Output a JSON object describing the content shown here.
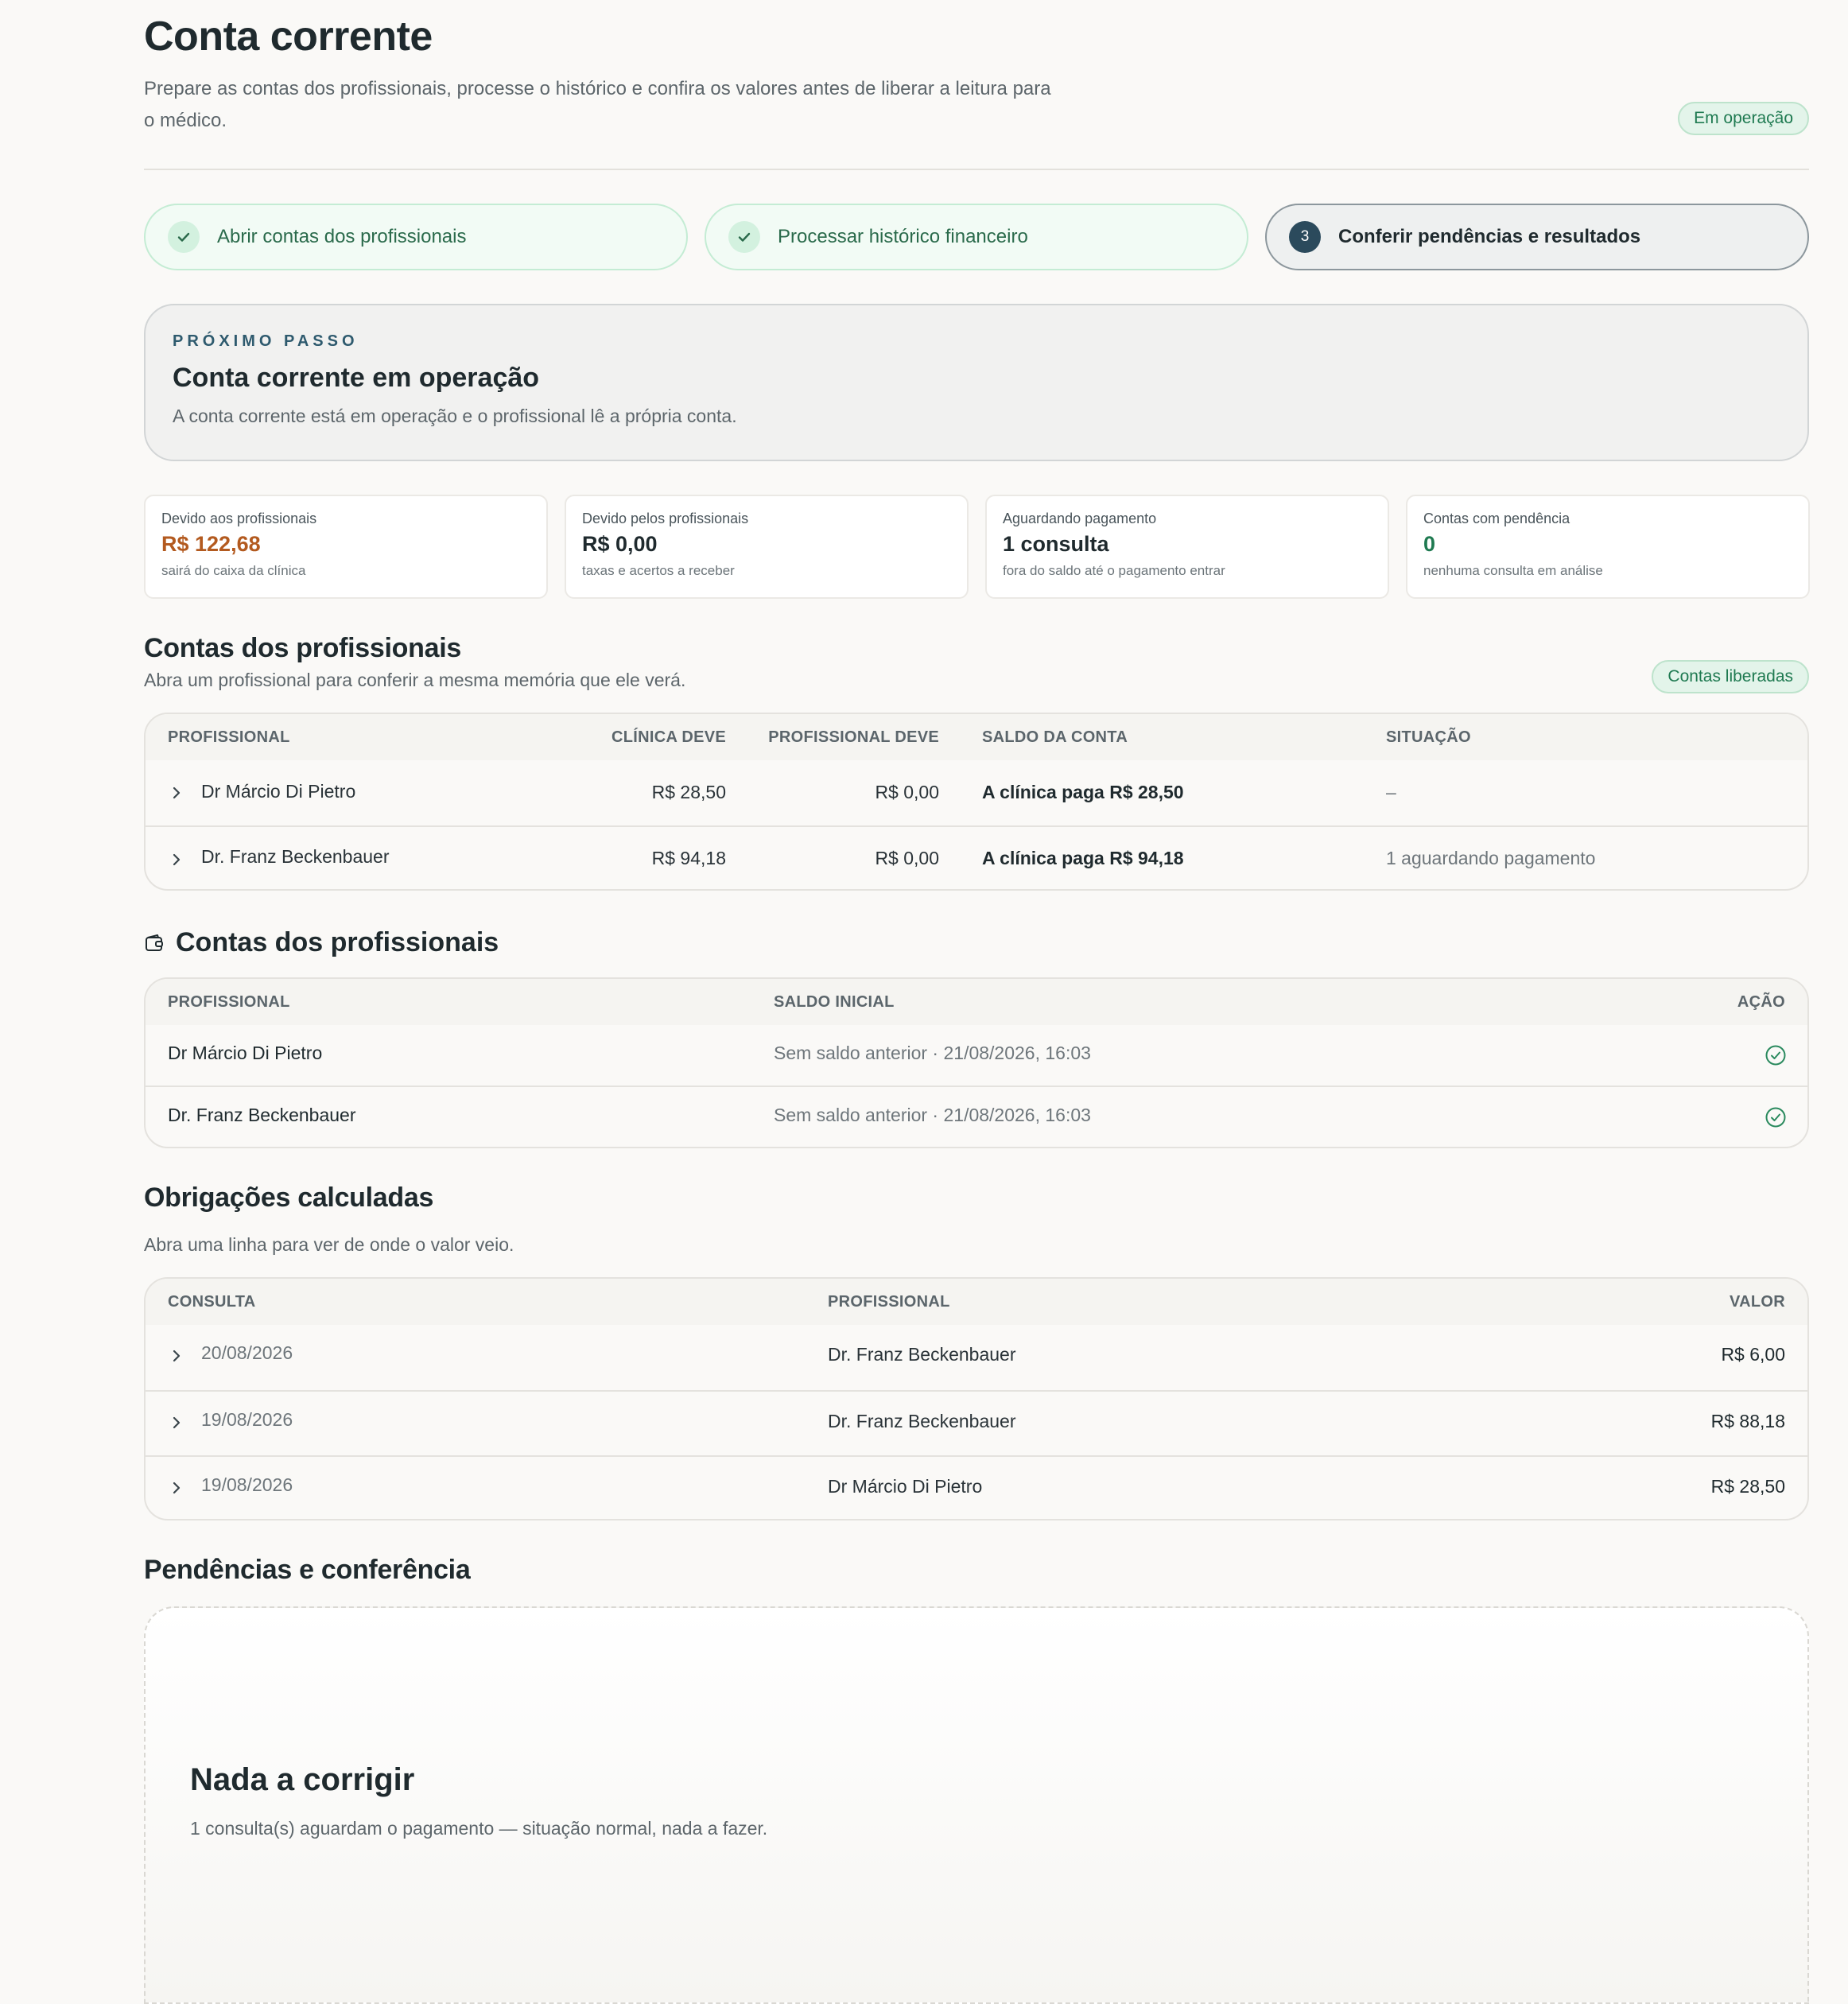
{
  "header": {
    "title": "Conta corrente",
    "subtitle": "Prepare as contas dos profissionais, processe o histórico e confira os valores antes de liberar a leitura para o médico.",
    "status": "Em operação"
  },
  "steps": [
    {
      "label": "Abrir contas dos profissionais",
      "state": "done"
    },
    {
      "label": "Processar histórico financeiro",
      "state": "done"
    },
    {
      "label": "Conferir pendências e resultados",
      "state": "current",
      "number": "3"
    }
  ],
  "next_step": {
    "kicker": "PRÓXIMO PASSO",
    "title": "Conta corrente em operação",
    "description": "A conta corrente está em operação e o profissional lê a própria conta."
  },
  "metrics": [
    {
      "label": "Devido aos profissionais",
      "value": "R$ 122,68",
      "note": "sairá do caixa da clínica",
      "color": "#b35a1f"
    },
    {
      "label": "Devido pelos profissionais",
      "value": "R$ 0,00",
      "note": "taxas e acertos a receber",
      "color": "#1f2a2e"
    },
    {
      "label": "Aguardando pagamento",
      "value": "1 consulta",
      "note": "fora do saldo até o pagamento entrar",
      "color": "#1f2a2e"
    },
    {
      "label": "Contas com pendência",
      "value": "0",
      "note": "nenhuma consulta em análise",
      "color": "#1f7a51"
    }
  ],
  "accounts": {
    "title": "Contas dos profissionais",
    "subtitle": "Abra um profissional para conferir a mesma memória que ele verá.",
    "badge": "Contas liberadas",
    "headers": {
      "professional": "PROFISSIONAL",
      "clinic_owes": "CLÍNICA DEVE",
      "pro_owes": "PROFISSIONAL DEVE",
      "balance": "SALDO DA CONTA",
      "status": "SITUAÇÃO"
    },
    "rows": [
      {
        "name": "Dr Márcio Di Pietro",
        "clinic_owes": "R$ 28,50",
        "pro_owes": "R$ 0,00",
        "balance": "A clínica paga R$ 28,50",
        "status": "–"
      },
      {
        "name": "Dr. Franz Beckenbauer",
        "clinic_owes": "R$ 94,18",
        "pro_owes": "R$ 0,00",
        "balance": "A clínica paga R$ 94,18",
        "status": "1 aguardando pagamento"
      }
    ]
  },
  "opening": {
    "title": "Contas dos profissionais",
    "icon": "wallet-icon",
    "headers": {
      "professional": "PROFISSIONAL",
      "initial": "SALDO INICIAL",
      "action": "AÇÃO"
    },
    "rows": [
      {
        "name": "Dr Márcio Di Pietro",
        "initial": "Sem saldo anterior · 21/08/2026, 16:03"
      },
      {
        "name": "Dr. Franz Beckenbauer",
        "initial": "Sem saldo anterior · 21/08/2026, 16:03"
      }
    ]
  },
  "obligations": {
    "title": "Obrigações calculadas",
    "subtitle": "Abra uma linha para ver de onde o valor veio.",
    "headers": {
      "consultation": "CONSULTA",
      "professional": "PROFISSIONAL",
      "value": "VALOR"
    },
    "rows": [
      {
        "date": "20/08/2026",
        "professional": "Dr. Franz Beckenbauer",
        "value": "R$ 6,00"
      },
      {
        "date": "19/08/2026",
        "professional": "Dr. Franz Beckenbauer",
        "value": "R$ 88,18"
      },
      {
        "date": "19/08/2026",
        "professional": "Dr Márcio Di Pietro",
        "value": "R$ 28,50"
      }
    ]
  },
  "pending": {
    "title": "Pendências e conferência",
    "empty_title": "Nada a corrigir",
    "empty_desc": "1 consulta(s) aguardam o pagamento — situação normal, nada a fazer."
  },
  "colors": {
    "accent": "#2b4a5c",
    "success": "#1f7a51",
    "warning": "#b35a1f"
  }
}
